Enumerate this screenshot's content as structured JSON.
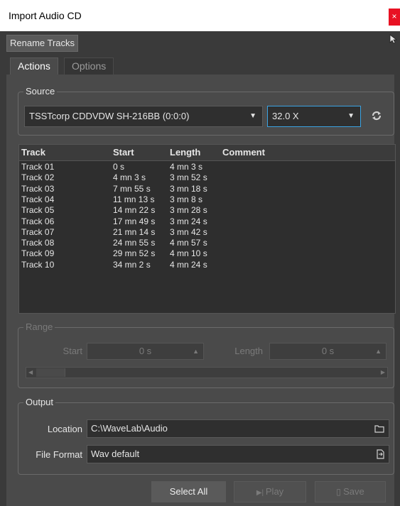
{
  "window": {
    "title": "Import Audio CD",
    "close": "×"
  },
  "toolbar": {
    "rename_tracks": "Rename Tracks"
  },
  "tabs": [
    {
      "label": "Actions"
    },
    {
      "label": "Options"
    }
  ],
  "source": {
    "legend": "Source",
    "drive": "TSSTcorp CDDVDW SH-216BB  (0:0:0)",
    "speed": "32.0 X"
  },
  "table": {
    "headers": [
      "Track",
      "Start",
      "Length",
      "Comment"
    ],
    "rows": [
      [
        "Track 01",
        "0 s",
        "4 mn 3 s",
        ""
      ],
      [
        "Track 02",
        "4 mn 3 s",
        "3 mn 52 s",
        ""
      ],
      [
        "Track 03",
        "7 mn 55 s",
        "3 mn 18 s",
        ""
      ],
      [
        "Track 04",
        "11 mn 13 s",
        "3 mn 8 s",
        ""
      ],
      [
        "Track 05",
        "14 mn 22 s",
        "3 mn 28 s",
        ""
      ],
      [
        "Track 06",
        "17 mn 49 s",
        "3 mn 24 s",
        ""
      ],
      [
        "Track 07",
        "21 mn 14 s",
        "3 mn 42 s",
        ""
      ],
      [
        "Track 08",
        "24 mn 55 s",
        "4 mn 57 s",
        ""
      ],
      [
        "Track 09",
        "29 mn 52 s",
        "4 mn 10 s",
        ""
      ],
      [
        "Track 10",
        "34 mn 2 s",
        "4 mn 24 s",
        ""
      ]
    ]
  },
  "range": {
    "legend": "Range",
    "start_label": "Start",
    "start_value": "0 s",
    "length_label": "Length",
    "length_value": "0 s"
  },
  "output": {
    "legend": "Output",
    "location_label": "Location",
    "location_value": "C:\\WaveLab\\Audio",
    "format_label": "File Format",
    "format_value": "Wav default"
  },
  "buttons": {
    "select_all": "Select All",
    "play": "Play",
    "save": "Save"
  },
  "colors": {
    "accent": "#3aa3e3",
    "close": "#e81123",
    "panel": "#4a4a4a"
  }
}
